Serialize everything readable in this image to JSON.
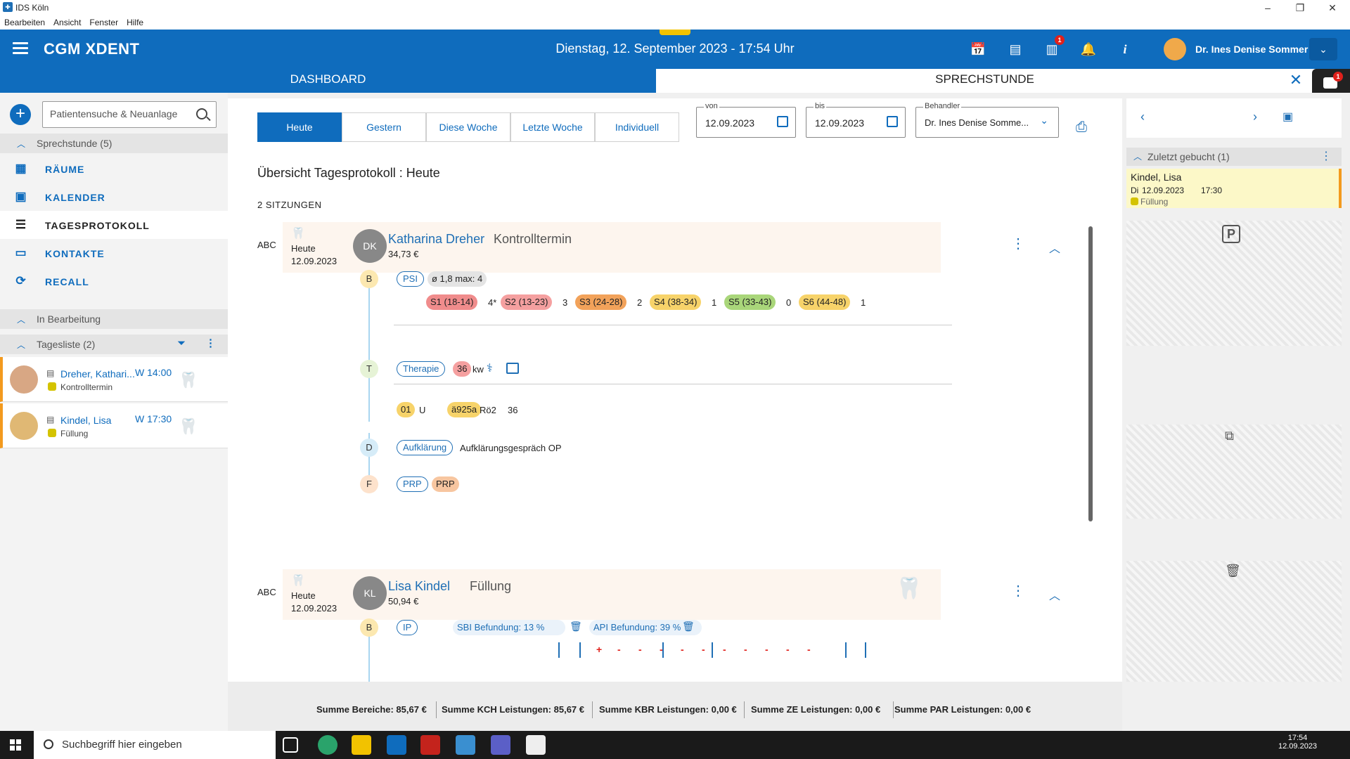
{
  "window": {
    "title": "IDS Köln",
    "menu": [
      "Bearbeiten",
      "Ansicht",
      "Fenster",
      "Hilfe"
    ]
  },
  "header": {
    "brand": "CGM XDENT",
    "date": "Dienstag, 12. September 2023 - 17:54 Uhr",
    "user": "Dr. Ines Denise Sommer",
    "badge_msgs": "1",
    "badge_chat": "1",
    "accent": "#0f6cbd"
  },
  "tabs": {
    "dashboard": "DASHBOARD",
    "sprechstunde": "SPRECHSTUNDE"
  },
  "sidebar": {
    "search_placeholder": "Patientensuche & Neuanlage",
    "section_sprechstunde": "Sprechstunde (5)",
    "nav": [
      {
        "label": "RÄUME",
        "icon": "rooms-icon"
      },
      {
        "label": "KALENDER",
        "icon": "calendar-icon"
      },
      {
        "label": "TAGESPROTOKOLL",
        "icon": "list-icon"
      },
      {
        "label": "KONTAKTE",
        "icon": "contacts-icon"
      },
      {
        "label": "RECALL",
        "icon": "recall-icon"
      }
    ],
    "section_bearbeitung": "In Bearbeitung",
    "section_tagesliste": "Tagesliste (2)",
    "patients": [
      {
        "name": "Dreher, Kathari...",
        "time": "W 14:00",
        "type": "Kontrolltermin"
      },
      {
        "name": "Kindel, Lisa",
        "time": "W 17:30",
        "type": "Füllung"
      }
    ]
  },
  "filters": {
    "tabs": [
      "Heute",
      "Gestern",
      "Diese Woche",
      "Letzte Woche",
      "Individuell"
    ],
    "von_label": "von",
    "von": "12.09.2023",
    "bis_label": "bis",
    "bis": "12.09.2023",
    "behandler_label": "Behandler",
    "behandler": "Dr. Ines Denise Somme..."
  },
  "main": {
    "title": "Übersicht Tagesprotokoll : Heute",
    "sessions_count": "2 SITZUNGEN"
  },
  "sessions": [
    {
      "abc": "ABC",
      "day": "Heute",
      "date": "12.09.2023",
      "initials": "DK",
      "name": "Katharina Dreher",
      "kind": "Kontrolltermin",
      "price": "34,73 €",
      "nodes": {
        "b": "B",
        "t": "T",
        "d": "D",
        "f": "F"
      },
      "psi": "PSI",
      "psi_avg": "ø 1,8 max: 4",
      "sextants": [
        {
          "label": "S1 (18-14)",
          "value": "4*",
          "color": "#f08c8c"
        },
        {
          "label": "S2 (13-23)",
          "value": "3",
          "color": "#f5a0a0"
        },
        {
          "label": "S3 (24-28)",
          "value": "2",
          "color": "#f2a25a"
        },
        {
          "label": "S4 (38-34)",
          "value": "1",
          "color": "#f7d36a"
        },
        {
          "label": "S5 (33-43)",
          "value": "0",
          "color": "#a9d67a"
        },
        {
          "label": "S6 (44-48)",
          "value": "1",
          "color": "#f7d36a"
        }
      ],
      "therapie": "Therapie",
      "therapie_num": "36",
      "therapie_unit": "kw",
      "codes": [
        {
          "code": "01",
          "extra": "U"
        },
        {
          "code": "ä925a",
          "extra": "Rö2",
          "extra2": "36"
        }
      ],
      "aufklaerung": "Aufklärung",
      "aufklaerung_text": "Aufklärungsgespräch OP",
      "prp1": "PRP",
      "prp2": "PRP"
    },
    {
      "abc": "ABC",
      "day": "Heute",
      "date": "12.09.2023",
      "initials": "KL",
      "name": "Lisa Kindel",
      "kind": "Füllung",
      "price": "50,94 €",
      "node_b": "B",
      "ip": "IP",
      "sbi": "SBI Befundung: 13 %",
      "api": "API Befundung: 39 %",
      "chart_marks": [
        "+",
        "-",
        "-",
        "-",
        "-",
        "-",
        "-",
        "-",
        "-",
        "-",
        "-"
      ]
    }
  ],
  "sums": [
    "Summe Bereiche: 85,67 €",
    "Summe KCH Leistungen: 85,67 €",
    "Summe KBR Leistungen: 0,00 €",
    "Summe ZE Leistungen: 0,00 €",
    "Summe PAR Leistungen: 0,00 €"
  ],
  "right": {
    "section": "Zuletzt gebucht (1)",
    "card": {
      "name": "Kindel, Lisa",
      "day": "Di",
      "date": "12.09.2023",
      "time": "17:30",
      "type": "Füllung"
    }
  },
  "taskbar": {
    "search": "Suchbegriff hier eingeben",
    "time": "17:54",
    "date": "12.09.2023"
  }
}
